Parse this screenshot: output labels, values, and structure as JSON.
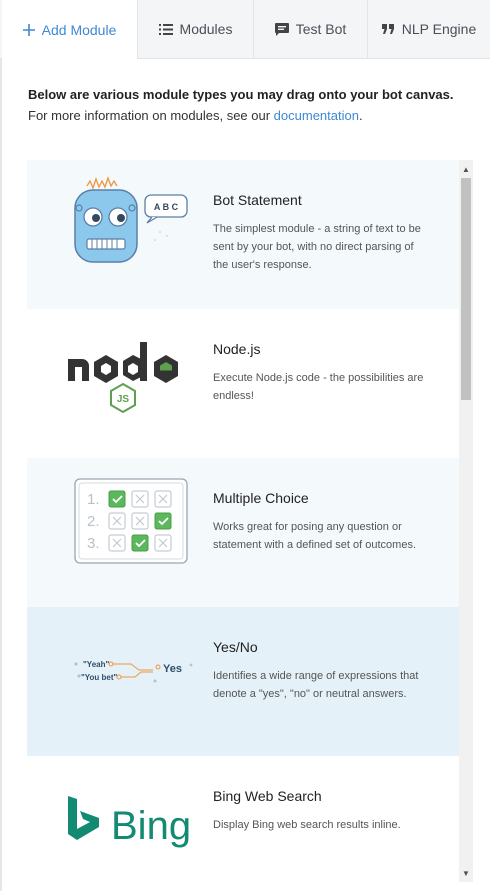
{
  "tabs": [
    {
      "label": "Add Module",
      "icon": "plus-icon",
      "active": true
    },
    {
      "label": "Modules",
      "icon": "list-icon"
    },
    {
      "label": "Test Bot",
      "icon": "chat-icon"
    },
    {
      "label": "NLP Engine",
      "icon": "quote-icon"
    }
  ],
  "intro": {
    "bold": "Below are various module types you may drag onto your bot canvas.",
    "text": "For more information on modules, see our ",
    "link": "documentation",
    "after": "."
  },
  "modules": [
    {
      "title": "Bot Statement",
      "desc": "The simplest module - a string of text to be sent by your bot, with no direct parsing of the user's response.",
      "bg": "#f4f9fc",
      "bubble": "A B C"
    },
    {
      "title": "Node.js",
      "desc": "Execute Node.js code - the possibilities are endless!",
      "bg": "#ffffff",
      "logo": "node",
      "sublogo": "JS"
    },
    {
      "title": "Multiple Choice",
      "desc": "Works great for posing any question or statement with a defined set of outcomes.",
      "bg": "#f4f9fc",
      "numbers": [
        "1.",
        "2.",
        "3."
      ]
    },
    {
      "title": "Yes/No",
      "desc": "Identifies a wide range of expressions that denote a \"yes\", \"no\" or neutral answers.",
      "bg": "#e5f1f8",
      "phrases": [
        "\"Yeah\"",
        "\"You bet\"",
        "Yes"
      ]
    },
    {
      "title": "Bing Web Search",
      "desc": "Display Bing web search results inline.",
      "bg": "#ffffff",
      "logo": "Bing"
    }
  ],
  "colors": {
    "accent": "#3f88d4",
    "check": "#5cb85c",
    "robot": "#8cc8ec",
    "node": "#333333",
    "node_green": "#5fa04e",
    "bing": "#138a72"
  }
}
